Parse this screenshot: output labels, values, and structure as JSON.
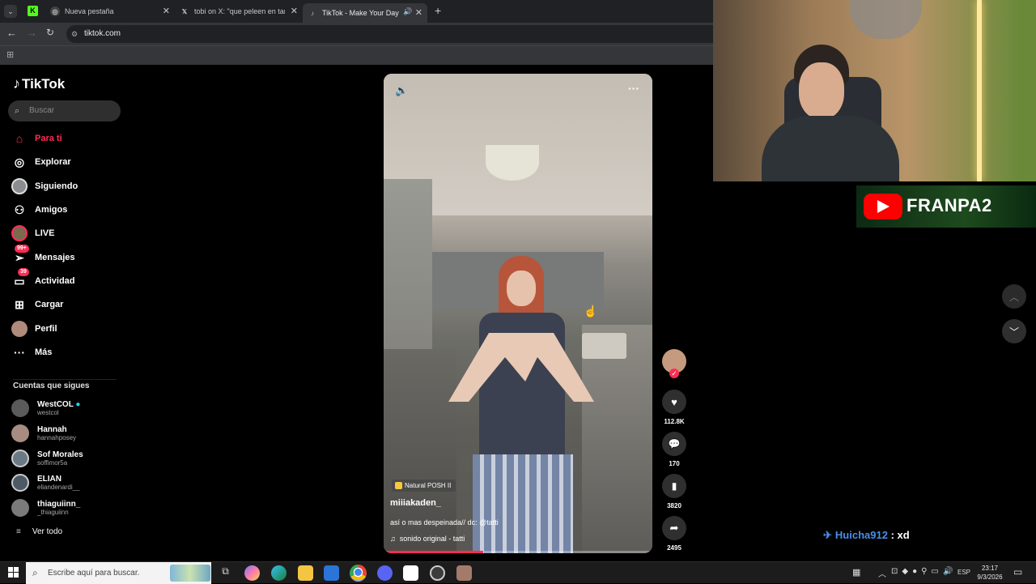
{
  "browser": {
    "tabs": [
      {
        "label": "Nueva pestaña",
        "active": false
      },
      {
        "label": "tobi on X: \"que peleen en tang",
        "active": false
      },
      {
        "label": "TikTok - Make Your Day",
        "active": true
      }
    ],
    "new_tab": "+",
    "url": "tiktok.com"
  },
  "sidebar": {
    "brand": "TikTok",
    "search_placeholder": "Buscar",
    "nav": [
      {
        "label": "Para ti",
        "icon": "home-icon",
        "active": true
      },
      {
        "label": "Explorar",
        "icon": "compass-icon"
      },
      {
        "label": "Siguiendo",
        "icon": "following-avatar"
      },
      {
        "label": "Amigos",
        "icon": "friends-icon"
      },
      {
        "label": "LIVE",
        "icon": "live-icon"
      },
      {
        "label": "Mensajes",
        "icon": "messages-icon",
        "badge": "99+"
      },
      {
        "label": "Actividad",
        "icon": "activity-icon",
        "badge": "39"
      },
      {
        "label": "Cargar",
        "icon": "upload-icon"
      },
      {
        "label": "Perfil",
        "icon": "profile-avatar"
      },
      {
        "label": "Más",
        "icon": "more-icon"
      }
    ],
    "following_title": "Cuentas que sigues",
    "accounts": [
      {
        "name": "WestCOL",
        "handle": "westcol",
        "verified": true
      },
      {
        "name": "Hannah",
        "handle": "hannahposey"
      },
      {
        "name": "Sof Morales",
        "handle": "soffimor5a"
      },
      {
        "name": "ELIAN",
        "handle": "eliandenardi__"
      },
      {
        "name": "thiaguiinn_",
        "handle": "_thiaguiinn"
      }
    ],
    "see_all": "Ver todo"
  },
  "video": {
    "ad_tag": "Natural POSH II",
    "author": "miiiakaden_",
    "caption": "así o mas despeinada// dc: @tatti",
    "sound": "sonido original - tatti",
    "progress": 0.37
  },
  "actions": {
    "likes": "112.8K",
    "comments": "170",
    "saves": "3820",
    "shares": "2495"
  },
  "stream": {
    "channel": "FRANPA2",
    "chat_user": "Huicha912",
    "chat_sep": ":",
    "chat_message": "xd"
  },
  "taskbar": {
    "search_placeholder": "Escribe aquí para buscar.",
    "lang": "ESP",
    "time": "23:17",
    "date": "9/3/2026"
  },
  "colors": {
    "tiktok_accent": "#fe2c55",
    "chat_user": "#4a8fe7",
    "youtube_red": "#ff0000"
  }
}
